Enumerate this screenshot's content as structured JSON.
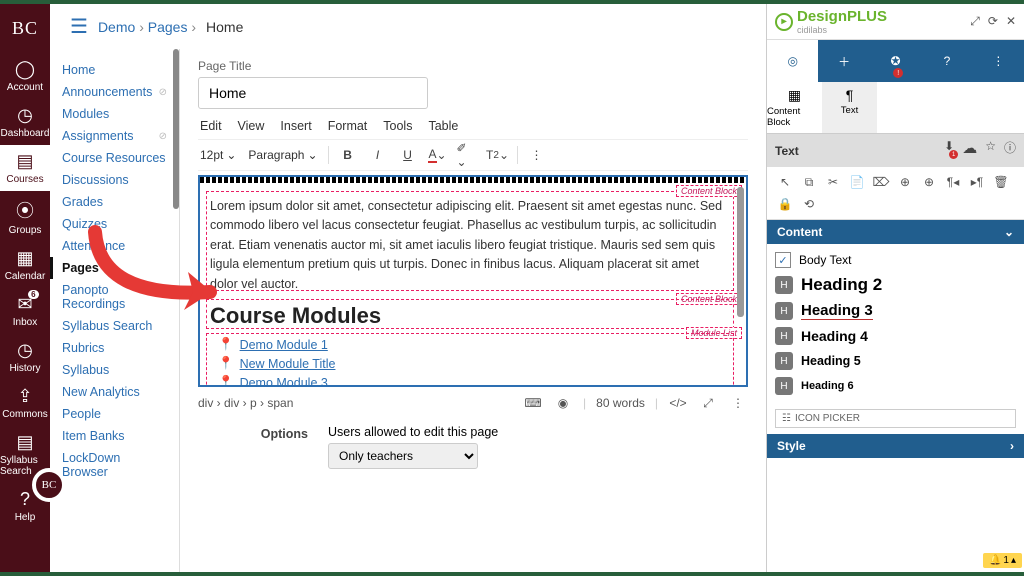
{
  "globalNav": {
    "logo": "BC",
    "items": [
      {
        "label": "Account",
        "icon": "user"
      },
      {
        "label": "Dashboard",
        "icon": "gauge"
      },
      {
        "label": "Courses",
        "icon": "book",
        "selected": true
      },
      {
        "label": "Groups",
        "icon": "people"
      },
      {
        "label": "Calendar",
        "icon": "calendar"
      },
      {
        "label": "Inbox",
        "icon": "inbox",
        "badge": "6"
      },
      {
        "label": "History",
        "icon": "clock"
      },
      {
        "label": "Commons",
        "icon": "share"
      },
      {
        "label": "Syllabus Search",
        "icon": "search"
      },
      {
        "label": "Help",
        "icon": "help"
      }
    ]
  },
  "breadcrumbs": {
    "items": [
      "Demo",
      "Pages"
    ],
    "current": "Home"
  },
  "courseNav": {
    "items": [
      {
        "label": "Home"
      },
      {
        "label": "Announcements",
        "hidden": true
      },
      {
        "label": "Modules"
      },
      {
        "label": "Assignments",
        "hidden": true
      },
      {
        "label": "Course Resources"
      },
      {
        "label": "Discussions"
      },
      {
        "label": "Grades"
      },
      {
        "label": "Quizzes"
      },
      {
        "label": "Attendance"
      },
      {
        "label": "Pages",
        "selected": true
      },
      {
        "label": "Panopto Recordings"
      },
      {
        "label": "Syllabus Search"
      },
      {
        "label": "Rubrics"
      },
      {
        "label": "Syllabus"
      },
      {
        "label": "New Analytics"
      },
      {
        "label": "People"
      },
      {
        "label": "Item Banks"
      },
      {
        "label": "LockDown Browser"
      }
    ]
  },
  "editor": {
    "pageTitleLabel": "Page Title",
    "pageTitleValue": "Home",
    "menus": [
      "Edit",
      "View",
      "Insert",
      "Format",
      "Tools",
      "Table"
    ],
    "fontSize": "12pt",
    "paragraph": "Paragraph",
    "body": "Lorem ipsum dolor sit amet, consectetur adipiscing elit. Praesent sit amet egestas nunc. Sed commodo libero vel lacus consectetur feugiat. Phasellus ac vestibulum turpis, ac sollicitudin erat. Etiam venenatis auctor mi, sit amet iaculis libero feugiat tristique. Mauris sed sem quis ligula elementum pretium quis ut turpis. Donec in finibus lacus. Aliquam placerat sit amet dolor vel auctor.",
    "heading": "Course Modules",
    "tags": {
      "cb": "Content Block",
      "ml": "Module List"
    },
    "modules": [
      "Demo Module 1",
      "New Module Title",
      "Demo Module 3"
    ],
    "path": "div › div › p › span",
    "wordCount": "80 words",
    "options": {
      "label": "Options",
      "editLabel": "Users allowed to edit this page",
      "value": "Only teachers"
    }
  },
  "dp": {
    "brand": "DesignPLUS",
    "brandSub": "cidilabs",
    "subTabs": [
      {
        "label": "Content Block"
      },
      {
        "label": "Text",
        "selected": true
      }
    ],
    "section": "Text",
    "accordion1": "Content",
    "contentItems": [
      {
        "label": "Body Text",
        "type": "check"
      },
      {
        "label": "Heading 2",
        "cls": "h2"
      },
      {
        "label": "Heading 3",
        "cls": "h3"
      },
      {
        "label": "Heading 4",
        "cls": "h4"
      },
      {
        "label": "Heading 5",
        "cls": "h5"
      },
      {
        "label": "Heading 6",
        "cls": "h6"
      }
    ],
    "iconPicker": "ICON PICKER",
    "accordion2": "Style",
    "notif": "1"
  }
}
